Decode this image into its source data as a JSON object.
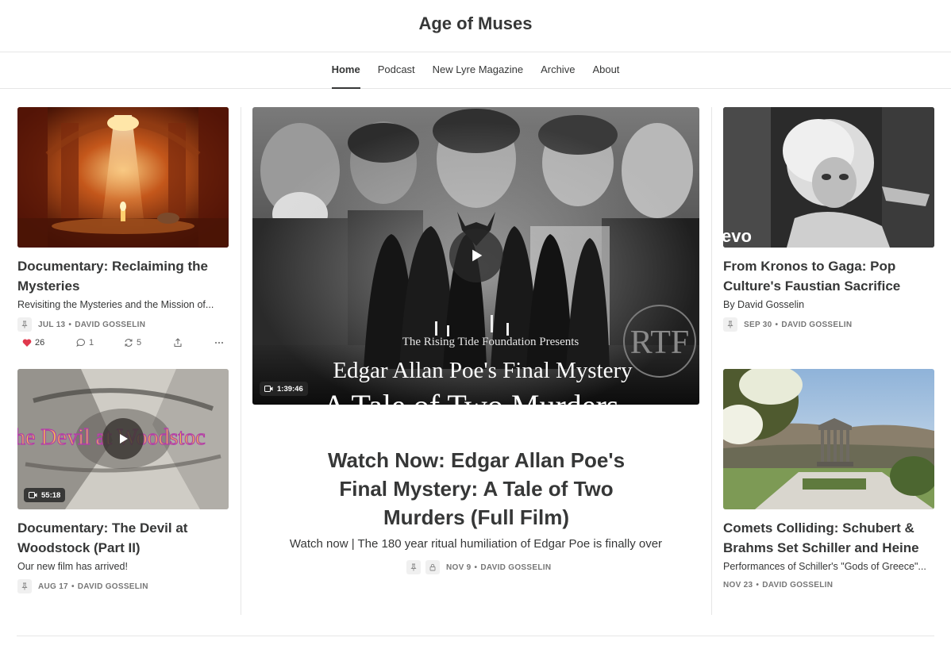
{
  "site": {
    "title": "Age of Muses"
  },
  "nav": [
    {
      "label": "Home",
      "active": true
    },
    {
      "label": "Podcast",
      "active": false
    },
    {
      "label": "New Lyre Magazine",
      "active": false
    },
    {
      "label": "Archive",
      "active": false
    },
    {
      "label": "About",
      "active": false
    }
  ],
  "posts": {
    "reclaiming": {
      "title": "Documentary: Reclaiming the Mysteries",
      "subtitle": "Revisiting the Mysteries and the Mission of...",
      "date": "JUL 13",
      "author": "DAVID GOSSELIN",
      "likes": "26",
      "comments": "1",
      "restacks": "5"
    },
    "woodstock": {
      "title": "Documentary: The Devil at Woodstock (Part II)",
      "subtitle": "Our new film has arrived!",
      "date": "AUG 17",
      "author": "DAVID GOSSELIN",
      "duration": "55:18",
      "thumb_text": "he Devil at Woodstoc"
    },
    "featured": {
      "title": "Watch Now: Edgar Allan Poe's Final Mystery: A Tale of Two Murders (Full Film)",
      "subtitle": "Watch now | The 180 year ritual humiliation of Edgar Poe is finally over",
      "date": "NOV 9",
      "author": "DAVID GOSSELIN",
      "duration": "1:39:46",
      "thumb_presents": "The Rising Tide Foundation Presents",
      "thumb_title": "Edgar Allan Poe's Final Mystery",
      "thumb_subtitle": "A Tale of Two Murders",
      "thumb_logo": "RTF"
    },
    "kronos": {
      "title": "From Kronos to Gaga: Pop Culture's Faustian Sacrifice",
      "subtitle": "By David Gosselin",
      "date": "SEP 30",
      "author": "DAVID GOSSELIN",
      "thumb_logo": "evo"
    },
    "comets": {
      "title": "Comets Colliding: Schubert & Brahms Set Schiller and Heine",
      "subtitle": "Performances of Schiller's \"Gods of Greece\"...",
      "date": "NOV 23",
      "author": "DAVID GOSSELIN"
    }
  },
  "meta_separator": "•",
  "colors": {
    "heart": "#e0394d",
    "text": "#363737",
    "muted": "#777777"
  }
}
